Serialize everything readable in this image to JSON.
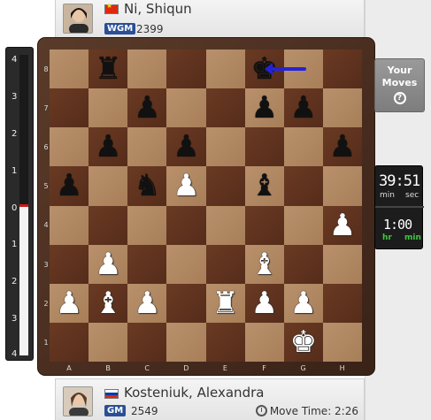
{
  "top_player": {
    "name": "Ni, Shiqun",
    "title": "WGM",
    "rating": "2399",
    "flag": "china-flag"
  },
  "bottom_player": {
    "name": "Kosteniuk, Alexandra",
    "title": "GM",
    "rating": "2549",
    "flag": "russia-flag",
    "move_time": "Move Time: 2:26"
  },
  "eval_bar": {
    "ticks_top": [
      "4",
      "3",
      "2",
      "1",
      "0"
    ],
    "ticks_bottom": [
      "1",
      "2",
      "3",
      "4"
    ],
    "white_share": 0.5
  },
  "board": {
    "ranks": [
      "8",
      "7",
      "6",
      "5",
      "4",
      "3",
      "2",
      "1"
    ],
    "files": [
      "A",
      "B",
      "C",
      "D",
      "E",
      "F",
      "G",
      "H"
    ],
    "rows": [
      [
        "",
        "bR",
        "",
        "",
        "",
        "bK",
        "",
        ""
      ],
      [
        "",
        "",
        "bP",
        "",
        "",
        "bP",
        "bP",
        ""
      ],
      [
        "",
        "bP",
        "",
        "bP",
        "",
        "",
        "",
        "bP"
      ],
      [
        "bP",
        "",
        "bN",
        "wP",
        "",
        "bB",
        "",
        ""
      ],
      [
        "",
        "",
        "",
        "",
        "",
        "",
        "",
        "wP"
      ],
      [
        "",
        "wP",
        "",
        "",
        "",
        "wB",
        "",
        ""
      ],
      [
        "wP",
        "wB",
        "wP",
        "",
        "wR",
        "wP",
        "wP",
        ""
      ],
      [
        "",
        "",
        "",
        "",
        "",
        "",
        "wK",
        ""
      ]
    ],
    "arrow_color": "#2323d6"
  },
  "your_moves": {
    "line1": "Your",
    "line2": "Moves",
    "icon": "?"
  },
  "clock": {
    "main": "39:51",
    "main_units": [
      "min",
      "sec"
    ],
    "increment": "1:00",
    "inc_units": [
      "hr",
      "min"
    ]
  }
}
